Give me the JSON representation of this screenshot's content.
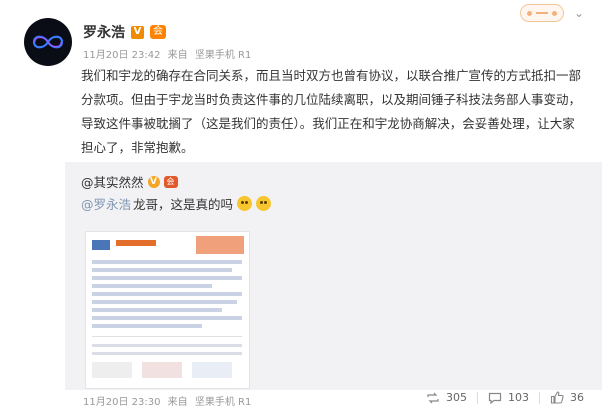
{
  "post": {
    "author": "罗永浩",
    "verified_mark": "V",
    "member_mark": "会",
    "time": "11月20日 23:42",
    "source_prefix": "来自",
    "source": "坚果手机 R1",
    "text": "我们和宇龙的确存在合同关系，而且当时双方也曾有协议，以联合推广宣传的方式抵扣一部分款项。但由于宇龙当时负责这件事的几位陆续离职，以及期间锤子科技法务部人事变动，导致这件事被耽搁了（这是我们的责任）。我们正在和宇龙协商解决，会妥善处理，让大家担心了，非常抱歉。"
  },
  "retweet": {
    "author": "@其实然然",
    "v_mark": "V",
    "vip_mark": "会",
    "mention": "@罗永浩",
    "text": " 龙哥，这是真的吗"
  },
  "footer": {
    "time": "11月20日 23:30",
    "source_prefix": "来自",
    "source": "坚果手机 R1"
  },
  "stats": {
    "reposts": "305",
    "comments": "103",
    "likes": "36"
  },
  "icons": {
    "more": "chevron-down-icon",
    "repost": "repost-icon",
    "comment": "comment-icon",
    "like": "like-icon"
  },
  "colors": {
    "link": "#7e96b2",
    "meta": "#999999",
    "retweet_bg": "#f2f2f5"
  }
}
